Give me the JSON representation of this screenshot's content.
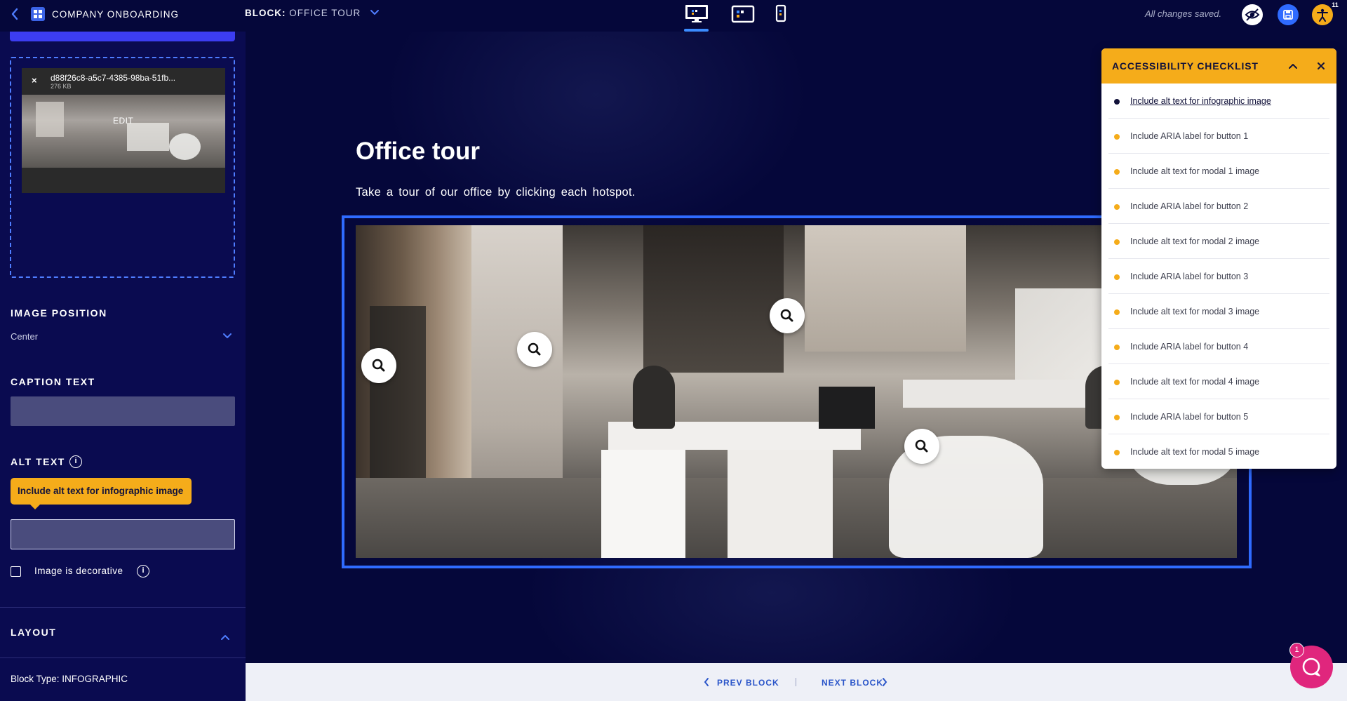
{
  "app": {
    "title": "COMPANY ONBOARDING"
  },
  "block_selector": {
    "prefix": "BLOCK:",
    "name": "OFFICE TOUR"
  },
  "status": {
    "saved_text": "All changes saved."
  },
  "accessibility_badge": {
    "count": "11"
  },
  "left_panel": {
    "file": {
      "name": "d88f26c8-a5c7-4385-98ba-51fb...",
      "size": "276 KB",
      "remove_label": "×",
      "edit_label": "EDIT"
    },
    "image_position": {
      "label": "IMAGE POSITION",
      "value": "Center"
    },
    "caption_text": {
      "label": "CAPTION TEXT",
      "value": ""
    },
    "alt_text": {
      "label": "ALT TEXT",
      "info": "i",
      "tooltip": "Include alt text for infographic image",
      "value": ""
    },
    "decorative": {
      "label": "Image is decorative",
      "info": "i",
      "checked": false
    },
    "layout": {
      "label": "LAYOUT"
    },
    "block_type": "Block Type: INFOGRAPHIC"
  },
  "canvas": {
    "heading": "Office tour",
    "subheading": "Take a tour of our office by clicking each hotspot.",
    "hotspots": [
      "Hotspot 1",
      "Hotspot 2",
      "Hotspot 3",
      "Hotspot 4"
    ]
  },
  "bottom_nav": {
    "prev": "PREV BLOCK",
    "next": "NEXT BLOCK"
  },
  "checklist": {
    "title": "ACCESSIBILITY CHECKLIST",
    "items": [
      {
        "text": "Include alt text for infographic image",
        "active": true
      },
      {
        "text": "Include ARIA label for button 1",
        "active": false
      },
      {
        "text": "Include alt text for modal 1 image",
        "active": false
      },
      {
        "text": "Include ARIA label for button 2",
        "active": false
      },
      {
        "text": "Include alt text for modal 2 image",
        "active": false
      },
      {
        "text": "Include ARIA label for button 3",
        "active": false
      },
      {
        "text": "Include alt text for modal 3 image",
        "active": false
      },
      {
        "text": "Include ARIA label for button 4",
        "active": false
      },
      {
        "text": "Include alt text for modal 4 image",
        "active": false
      },
      {
        "text": "Include ARIA label for button 5",
        "active": false
      },
      {
        "text": "Include alt text for modal 5 image",
        "active": false
      }
    ]
  },
  "chat": {
    "badge": "1"
  },
  "colors": {
    "accent": "#2f6bff",
    "warning": "#f5ac1a",
    "background": "#05073a",
    "panel": "#0a0b50",
    "chat": "#e0267d"
  },
  "icons": [
    "chevron-left-icon",
    "grid-icon",
    "chevron-down-icon",
    "desktop-icon",
    "tablet-icon",
    "mobile-icon",
    "preview-eye-icon",
    "save-icon",
    "accessibility-icon",
    "info-icon",
    "chevron-up-icon",
    "close-icon",
    "search-icon",
    "chevron-right-icon",
    "chat-icon"
  ]
}
